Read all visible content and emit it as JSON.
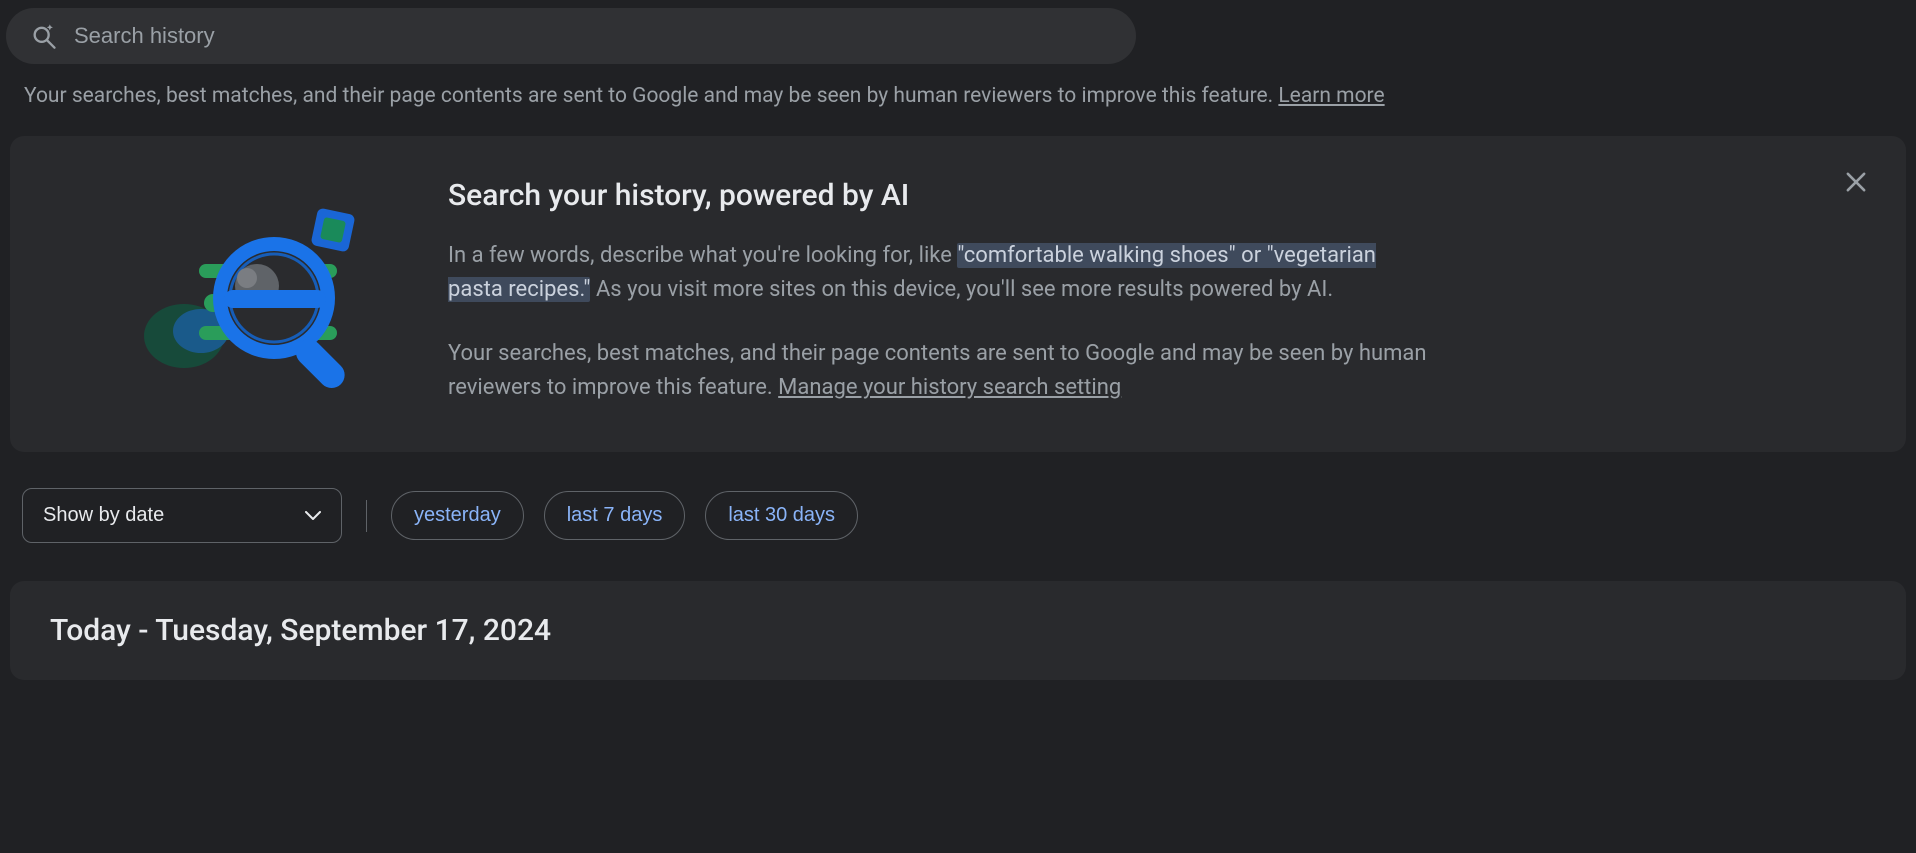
{
  "search": {
    "placeholder": "Search history"
  },
  "disclosure": {
    "text": "Your searches, best matches, and their page contents are sent to Google and may be seen by human reviewers to improve this feature. ",
    "link": "Learn more"
  },
  "infoCard": {
    "title": "Search your history, powered by AI",
    "body_prefix": "In a few words, describe what you're looking for, like ",
    "body_highlight": "\"comfortable walking shoes\" or \"vegetarian pasta recipes.\"",
    "body_suffix": " As you visit more sites on this device, you'll see more results powered by AI.",
    "privacy_text": "Your searches, best matches, and their page contents are sent to Google and may be seen by human reviewers to improve this feature. ",
    "privacy_link": "Manage your history search setting"
  },
  "filters": {
    "select_label": "Show by date",
    "chips": {
      "yesterday": "yesterday",
      "last7": "last 7 days",
      "last30": "last 30 days"
    }
  },
  "dateGroup": {
    "heading": "Today - Tuesday, September 17, 2024"
  }
}
